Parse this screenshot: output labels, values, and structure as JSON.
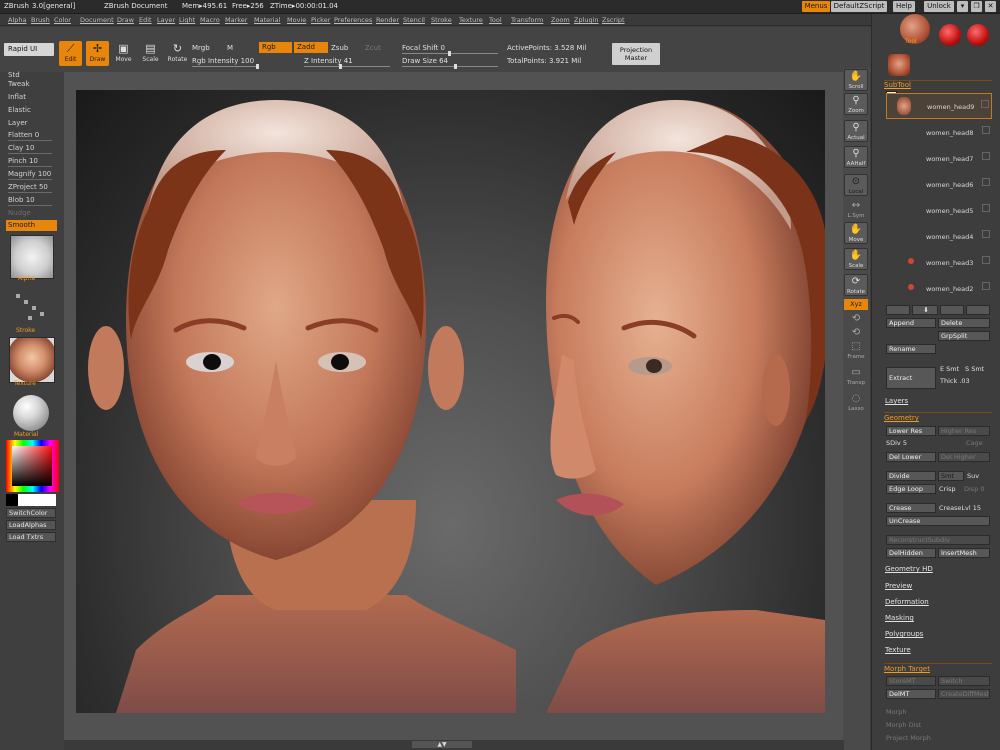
{
  "titlebar": {
    "app": "ZBrush",
    "version": "3.0[general]",
    "document": "ZBrush Document",
    "mem": "Mem▸495.61",
    "free": "Free▸256",
    "ztime": "ZTime▸00:00:01.04",
    "menus": "Menus",
    "script": "DefaultZScript",
    "help": "Help",
    "unlock": "Unlock"
  },
  "menubar": [
    "Alpha",
    "Brush",
    "Color",
    "Document",
    "Draw",
    "Edit",
    "Layer",
    "Light",
    "Macro",
    "Marker",
    "Material",
    "Movie",
    "Picker",
    "Preferences",
    "Render",
    "Stencil",
    "Stroke",
    "Texture",
    "Tool",
    "Transform",
    "Zoom",
    "Zplugin",
    "Zscript"
  ],
  "toolbar": {
    "rapid_ui": "Rapid UI",
    "edit": "Edit",
    "draw": "Draw",
    "move": "Move",
    "scale": "Scale",
    "rotate": "Rotate",
    "mrgb": "Mrgb",
    "m": "M",
    "rgb": "Rgb",
    "zadd": "Zadd",
    "zsub": "Zsub",
    "zcut": "Zcut",
    "rgb_intensity": "Rgb Intensity 100",
    "z_intensity": "Z Intensity 41",
    "focal_shift": "Focal Shift 0",
    "draw_size": "Draw Size 64",
    "active_points": "ActivePoints: 3.528 Mil",
    "total_points": "TotalPoints: 3.921 Mil",
    "projection_master_1": "Projection",
    "projection_master_2": "Master"
  },
  "leftpanel": {
    "items": [
      "Std",
      "Tweak",
      "Inflat",
      "Elastic",
      "Layer",
      "Flatten 0",
      "Clay 10",
      "Pinch 10",
      "Magnify 100",
      "ZProject 50",
      "Blob 10",
      "Nudge",
      "Smooth"
    ],
    "alpha_label": "Alpha",
    "stroke_label": "Stroke",
    "texture_label": "Texture",
    "material_label": "Material",
    "switch_color": "SwitchColor",
    "load_alphas": "LoadAlphas",
    "load_txtrs": "Load Txtrs"
  },
  "shelf": [
    "Scroll",
    "Zoom",
    "Actual",
    "AAHalf",
    "Local",
    "L.Sym",
    "Move",
    "Scale",
    "Rotate",
    "Xyz",
    "",
    "",
    "Frame",
    "Transp",
    "Lasso"
  ],
  "rightpanel": {
    "tool_label": "Tool",
    "subtool_header": "SubTool",
    "subtools": [
      "women_head9",
      "women_head8",
      "women_head7",
      "women_head6",
      "women_head5",
      "women_head4",
      "women_head3",
      "women_head2"
    ],
    "append": "Append",
    "delete": "Delete",
    "grpsplit": "GrpSplit",
    "rename": "Rename",
    "extract": "Extract",
    "e_smt": "E Smt",
    "s_smt": "S Smt",
    "thick": "Thick .03",
    "layers": "Layers",
    "geometry": "Geometry",
    "lower_res": "Lower Res",
    "higher_res": "Higher Res",
    "sdiv": "SDiv 5",
    "cage": "Cage",
    "del_lower": "Del Lower",
    "del_higher": "Del Higher",
    "divide": "Divide",
    "smt": "Smt",
    "suv": "Suv",
    "edge_loop": "Edge Loop",
    "crisp": "Crisp",
    "disp": "Disp 0",
    "crease": "Crease",
    "crease_lvl": "CreaseLvl 15",
    "uncrease": "UnCrease",
    "reconstruct": "ReconstructSubdiv",
    "delhidden": "DelHidden",
    "insertmesh": "InsertMesh",
    "geometry_hd": "Geometry HD",
    "preview": "Preview",
    "deformation": "Deformation",
    "masking": "Masking",
    "polygroups": "Polygroups",
    "texture": "Texture",
    "morph_target": "Morph Target",
    "store_mt": "StoreMT",
    "switch": "Switch",
    "delmt": "DelMT",
    "createdifmesh": "CreateDiffMesh",
    "morph": "Morph",
    "morph_dist": "Morph Dist",
    "project_morph": "Project Morph"
  },
  "colors": {
    "accent": "#e8860c",
    "panel": "#3d3d3d",
    "toolbar": "#444444"
  }
}
